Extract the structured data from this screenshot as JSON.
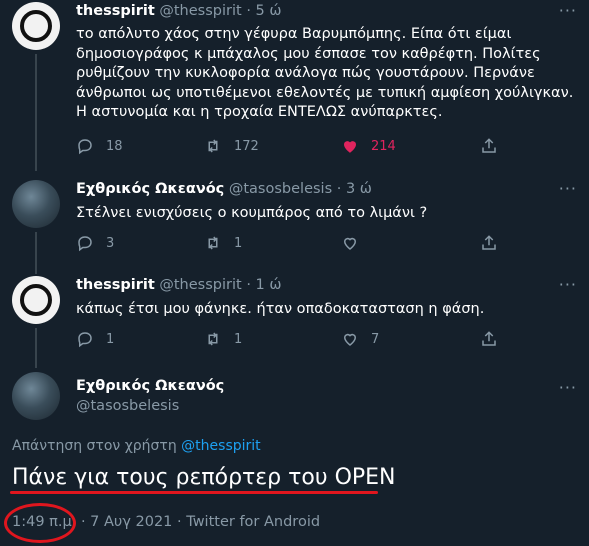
{
  "tweets": [
    {
      "name": "thesspirit",
      "handle": "@thesspirit",
      "time": "· 5 ώ",
      "text": "το απόλυτο χάος στην γέφυρα Βαρυμπόμπης. Είπα ότι είμαι δημοσιογράφος κ μπάχαλος μου έσπασε τον καθρέφτη. Πολίτες ρυθμίζουν την κυκλοφορία ανάλογα πώς γουστάρουν. Περνάνε άνθρωποι ως υποτιθέμενοι εθελοντές με τυπική αμφίεση χούλιγκαν. Η αστυνομία και η τροχαία ΕΝΤΕΛΩΣ ανύπαρκτες.",
      "replies": "18",
      "retweets": "172",
      "likes": "214"
    },
    {
      "name": "Εχθρικός Ωκεανός",
      "handle": "@tasosbelesis",
      "time": "· 3 ώ",
      "text": "Στέλνει ενισχύσεις ο κουμπάρος από το λιμάνι ?",
      "replies": "3",
      "retweets": "1",
      "likes": ""
    },
    {
      "name": "thesspirit",
      "handle": "@thesspirit",
      "time": "· 1 ώ",
      "text": "κάπως έτσι μου φάνηκε. ήταν οπαδοκατασταση η φάση.",
      "replies": "1",
      "retweets": "1",
      "likes": "7"
    }
  ],
  "main": {
    "name": "Εχθρικός Ωκεανός",
    "handle": "@tasosbelesis",
    "reply_prefix": "Απάντηση στον χρήστη",
    "reply_user": "@thesspirit",
    "text": "Πάνε για τους ρεπόρτερ του OPEN",
    "time": "1:49 π.μ.",
    "date": " · 7 Αυγ 2021 · Twitter for Android"
  },
  "more_glyph": "···",
  "colors": {
    "background": "#15202b",
    "accent": "#1da1f2",
    "like": "#e0245e",
    "annotation": "#e0161e"
  }
}
